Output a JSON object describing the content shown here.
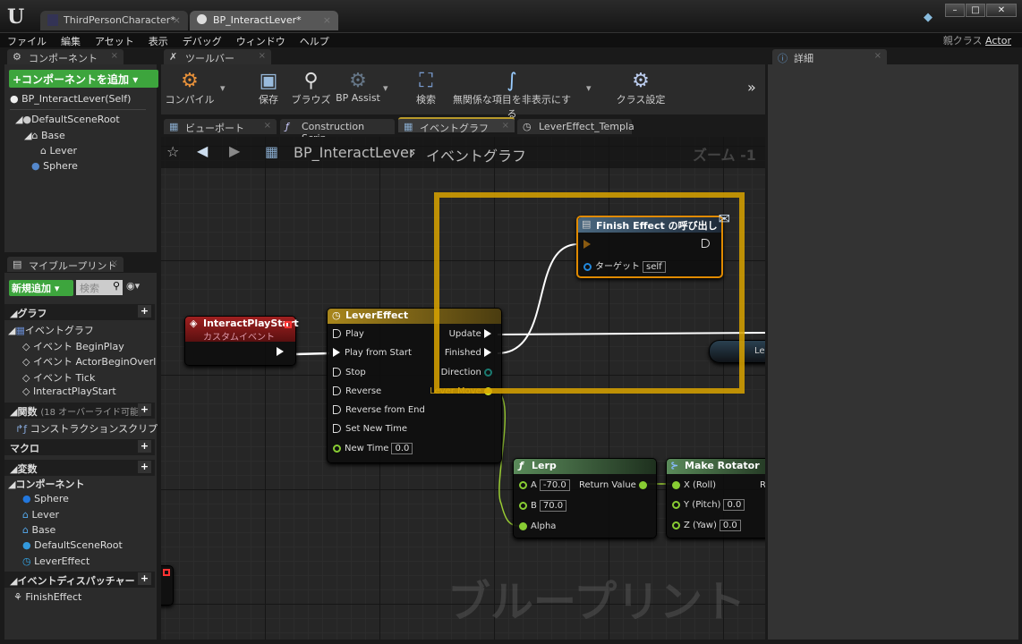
{
  "window": {
    "tabs": [
      {
        "label": "ThirdPersonCharacter*"
      },
      {
        "label": "BP_InteractLever*"
      }
    ],
    "controls": [
      "–",
      "□",
      "✕"
    ]
  },
  "menu": [
    "ファイル",
    "編集",
    "アセット",
    "表示",
    "デバッグ",
    "ウィンドウ",
    "ヘルプ"
  ],
  "parent_class": {
    "label": "親クラス",
    "value": "Actor"
  },
  "components": {
    "tab": "コンポーネント",
    "add_button": "+コンポーネントを追加",
    "self": "BP_InteractLever(Self)",
    "tree": [
      {
        "label": "DefaultSceneRoot"
      },
      {
        "label": "Base"
      },
      {
        "label": "Lever"
      },
      {
        "label": "Sphere"
      }
    ]
  },
  "my_blueprint": {
    "tab": "マイブループリント",
    "add_new": "新規追加",
    "search_placeholder": "検索",
    "graphs": {
      "title": "グラフ",
      "event_graph": "イベントグラフ",
      "events": [
        "イベント BeginPlay",
        "イベント ActorBeginOverl",
        "イベント Tick",
        "InteractPlayStart"
      ]
    },
    "functions": {
      "title": "関数",
      "note": "(18 オーバーライド可能)",
      "items": [
        "コンストラクションスクリプ"
      ]
    },
    "macros": {
      "title": "マクロ"
    },
    "variables": {
      "title": "変数",
      "group": "コンポーネント",
      "items": [
        "Sphere",
        "Lever",
        "Base",
        "DefaultSceneRoot",
        "LeverEffect"
      ]
    },
    "dispatchers": {
      "title": "イベントディスパッチャー",
      "items": [
        "FinishEffect"
      ]
    }
  },
  "toolbar": {
    "tab": "ツールバー",
    "buttons": [
      "コンパイル",
      "保存",
      "ブラウズ",
      "BP Assist",
      "検索",
      "無関係な項目を非表示にする",
      "クラス設定"
    ],
    "more": "»"
  },
  "doc_tabs": [
    "ビューポート",
    "Construction Scrip",
    "イベントグラフ",
    "LeverEffect_Templa"
  ],
  "graph": {
    "breadcrumb": [
      "BP_InteractLever",
      "イベントグラフ"
    ],
    "zoom": "ズーム -1",
    "watermark": "ブループリント",
    "nodes": {
      "event": {
        "title": "InteractPlayStart",
        "subtitle": "カスタムイベント"
      },
      "timeline": {
        "title": "LeverEffect",
        "inputs": [
          "Play",
          "Play from Start",
          "Stop",
          "Reverse",
          "Reverse from End",
          "Set New Time"
        ],
        "new_time_label": "New Time",
        "new_time": "0.0",
        "outputs": [
          "Update",
          "Finished",
          "Direction",
          "Lever Move"
        ]
      },
      "call": {
        "title": "Finish Effect の呼び出し",
        "target_label": "ターゲット",
        "target": "self"
      },
      "lerp": {
        "title": "Lerp",
        "a_label": "A",
        "a": "-70.0",
        "b_label": "B",
        "b": "70.0",
        "alpha": "Alpha",
        "ret": "Return Value"
      },
      "rotator": {
        "title": "Make Rotator",
        "x": "X (Roll)",
        "y_label": "Y (Pitch)",
        "y": "0.0",
        "z_label": "Z (Yaw)",
        "z": "0.0",
        "out": "R"
      },
      "partial": {
        "title": "Le"
      }
    },
    "highlight_color": "#d9a300"
  },
  "details": {
    "tab": "詳細"
  }
}
